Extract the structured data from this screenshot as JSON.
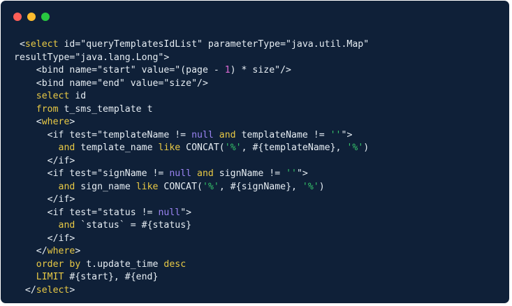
{
  "window": {
    "background": "#0f2038",
    "buttons": [
      {
        "name": "close",
        "color": "#ff5f57"
      },
      {
        "name": "minimize",
        "color": "#febc2e"
      },
      {
        "name": "zoom",
        "color": "#28c840"
      }
    ]
  },
  "colors": {
    "default": "#e6edf3",
    "keyword": "#e8c945",
    "operator": "#e06bd6",
    "null": "#9a83f2",
    "number": "#e06bd6",
    "string": "#35c46a"
  },
  "code": [
    [
      {
        "t": " <",
        "c": "default"
      },
      {
        "t": "select",
        "c": "keyword"
      },
      {
        "t": " id=\"queryTemplatesIdList\" parameterType=\"java.util.Map\"",
        "c": "default"
      }
    ],
    [
      {
        "t": "resultType=\"java.lang.Long\">",
        "c": "default"
      }
    ],
    [
      {
        "t": "    <bind name=\"start\" value=\"(page - ",
        "c": "default"
      },
      {
        "t": "1",
        "c": "number"
      },
      {
        "t": ") * size\"/>",
        "c": "default"
      }
    ],
    [
      {
        "t": "    <bind name=\"end\" value=\"size\"/>",
        "c": "default"
      }
    ],
    [
      {
        "t": "    ",
        "c": "default"
      },
      {
        "t": "select",
        "c": "keyword"
      },
      {
        "t": " id",
        "c": "default"
      }
    ],
    [
      {
        "t": "    ",
        "c": "default"
      },
      {
        "t": "from",
        "c": "keyword"
      },
      {
        "t": " t_sms_template t",
        "c": "default"
      }
    ],
    [
      {
        "t": "    <",
        "c": "default"
      },
      {
        "t": "where",
        "c": "keyword"
      },
      {
        "t": ">",
        "c": "default"
      }
    ],
    [
      {
        "t": "      <if test=\"templateName != ",
        "c": "default"
      },
      {
        "t": "null",
        "c": "null"
      },
      {
        "t": " ",
        "c": "default"
      },
      {
        "t": "and",
        "c": "keyword"
      },
      {
        "t": " templateName != ",
        "c": "default"
      },
      {
        "t": "''",
        "c": "string"
      },
      {
        "t": "\">",
        "c": "default"
      }
    ],
    [
      {
        "t": "        ",
        "c": "default"
      },
      {
        "t": "and",
        "c": "keyword"
      },
      {
        "t": " template_name ",
        "c": "default"
      },
      {
        "t": "like",
        "c": "keyword"
      },
      {
        "t": " CONCAT(",
        "c": "default"
      },
      {
        "t": "'%'",
        "c": "string"
      },
      {
        "t": ", #{templateName}, ",
        "c": "default"
      },
      {
        "t": "'%'",
        "c": "string"
      },
      {
        "t": ")",
        "c": "default"
      }
    ],
    [
      {
        "t": "      </if>",
        "c": "default"
      }
    ],
    [
      {
        "t": "      <if test=\"signName != ",
        "c": "default"
      },
      {
        "t": "null",
        "c": "null"
      },
      {
        "t": " ",
        "c": "default"
      },
      {
        "t": "and",
        "c": "keyword"
      },
      {
        "t": " signName != ",
        "c": "default"
      },
      {
        "t": "''",
        "c": "string"
      },
      {
        "t": "\">",
        "c": "default"
      }
    ],
    [
      {
        "t": "        ",
        "c": "default"
      },
      {
        "t": "and",
        "c": "keyword"
      },
      {
        "t": " sign_name ",
        "c": "default"
      },
      {
        "t": "like",
        "c": "keyword"
      },
      {
        "t": " CONCAT(",
        "c": "default"
      },
      {
        "t": "'%'",
        "c": "string"
      },
      {
        "t": ", #{signName}, ",
        "c": "default"
      },
      {
        "t": "'%'",
        "c": "string"
      },
      {
        "t": ")",
        "c": "default"
      }
    ],
    [
      {
        "t": "      </if>",
        "c": "default"
      }
    ],
    [
      {
        "t": "      <if test=\"status != ",
        "c": "default"
      },
      {
        "t": "null",
        "c": "null"
      },
      {
        "t": "\">",
        "c": "default"
      }
    ],
    [
      {
        "t": "        ",
        "c": "default"
      },
      {
        "t": "and",
        "c": "keyword"
      },
      {
        "t": " `status` = #{status}",
        "c": "default"
      }
    ],
    [
      {
        "t": "      </if>",
        "c": "default"
      }
    ],
    [
      {
        "t": "    </",
        "c": "default"
      },
      {
        "t": "where",
        "c": "keyword"
      },
      {
        "t": ">",
        "c": "default"
      }
    ],
    [
      {
        "t": "    ",
        "c": "default"
      },
      {
        "t": "order by",
        "c": "keyword"
      },
      {
        "t": " t.update_time ",
        "c": "default"
      },
      {
        "t": "desc",
        "c": "keyword"
      }
    ],
    [
      {
        "t": "    ",
        "c": "default"
      },
      {
        "t": "LIMIT",
        "c": "keyword"
      },
      {
        "t": " #{start}, #{end}",
        "c": "default"
      }
    ],
    [
      {
        "t": "  </",
        "c": "default"
      },
      {
        "t": "select",
        "c": "keyword"
      },
      {
        "t": ">",
        "c": "default"
      }
    ]
  ]
}
